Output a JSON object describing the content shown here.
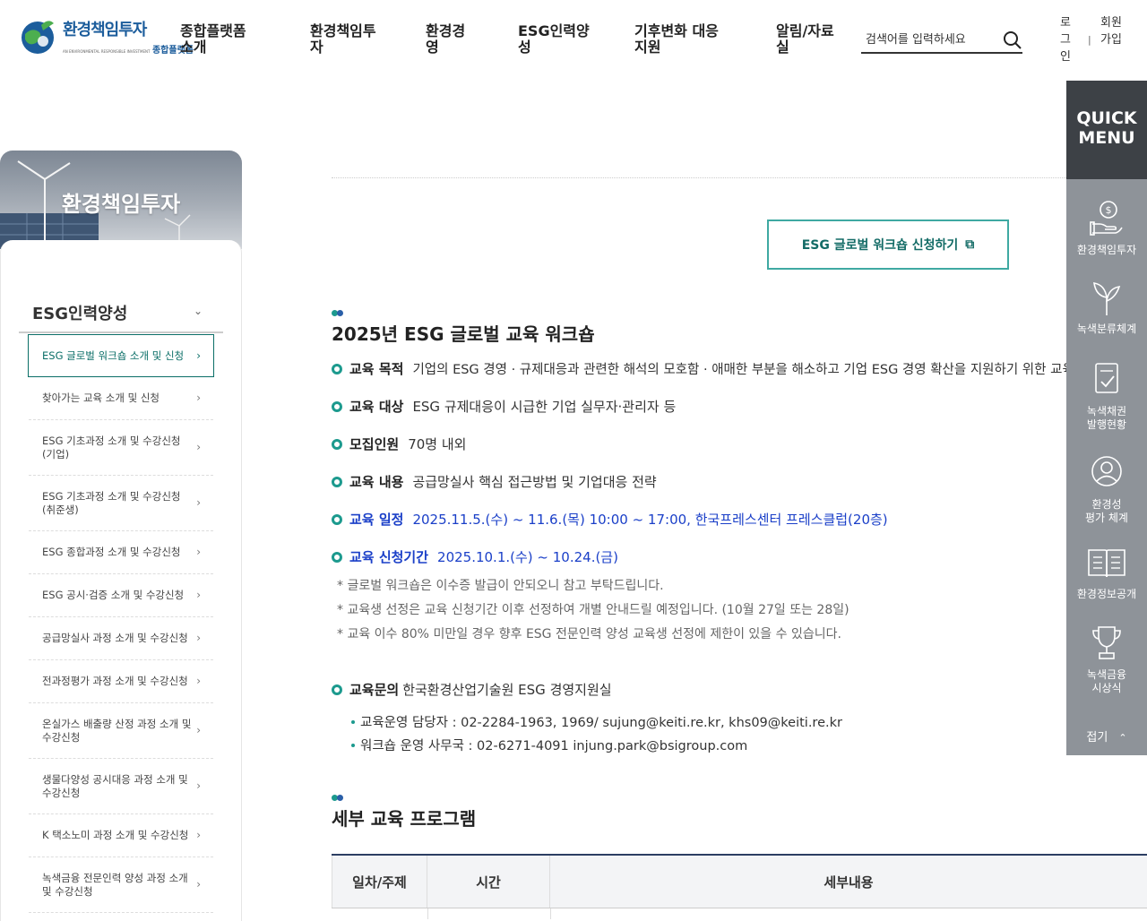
{
  "header": {
    "logo_title": "환경책임투자",
    "logo_sub_en": "AN ENVIRONMENTAL RESPONSIBLE INVESTMENT",
    "logo_sub_kr": "종합플랫폼",
    "nav": [
      {
        "line1": "종합플랫폼",
        "line2": "소개"
      },
      {
        "line1": "환경책임투",
        "line2": "자"
      },
      {
        "line1": "환경경",
        "line2": "영"
      },
      {
        "line1": "ESG인력양",
        "line2": "성"
      },
      {
        "line1": "기후변화 대응",
        "line2": "지원"
      },
      {
        "line1": "알림/자료",
        "line2": "실"
      }
    ],
    "search_placeholder": "검색어를 입력하세요",
    "login": [
      "로",
      "그",
      "인"
    ],
    "separator": "|",
    "join": [
      "회원",
      "가입"
    ]
  },
  "sidebar": {
    "banner_title": "환경책임투자",
    "heading": "ESG인력양성",
    "items": [
      {
        "line1": "ESG 글로벌 워크숍 소개 및 신청",
        "line2": ""
      },
      {
        "line1": "찾아가는 교육 소개 및 신청",
        "line2": ""
      },
      {
        "line1": "ESG 기초과정 소개 및 수강신청",
        "line2": "(기업)"
      },
      {
        "line1": "ESG 기초과정 소개 및 수강신청",
        "line2": "(취준생)"
      },
      {
        "line1": "ESG 종합과정 소개 및 수강신청",
        "line2": ""
      },
      {
        "line1": "ESG 공시·검증 소개 및 수강신청",
        "line2": ""
      },
      {
        "line1": "공급망실사 과정 소개 및 수강신청",
        "line2": ""
      },
      {
        "line1": "전과정평가 과정 소개 및 수강신청",
        "line2": ""
      },
      {
        "line1": "온실가스 배출량 산정 과정 소개 및",
        "line2": "수강신청"
      },
      {
        "line1": "생물다양성 공시대응 과정 소개 및",
        "line2": "수강신청"
      },
      {
        "line1": "K 택소노미 과정 소개 및 수강신청",
        "line2": ""
      },
      {
        "line1": "녹색금융 전문인력 양성 과정 소개",
        "line2": "및 수강신청"
      }
    ]
  },
  "main": {
    "apply_button": "ESG 글로벌 워크숍 신청하기",
    "section1_title": "2025년 ESG 글로벌 교육 워크숍",
    "info": [
      {
        "label": "교육 목적",
        "value": "기업의 ESG 경영 · 규제대응과 관련한 해석의 모호함 · 애매한 부분을 해소하고 기업 ESG 경영 확산을 지원하기 위한 교육의 장 마련"
      },
      {
        "label": "교육 대상",
        "value": "ESG 규제대응이 시급한 기업 실무자·관리자 등"
      },
      {
        "label": "모집인원",
        "value": "70명 내외"
      },
      {
        "label": "교육 내용",
        "value": "공급망실사 핵심 접근방법 및 기업대응 전략"
      },
      {
        "label": "교육 일정",
        "value": "2025.11.5.(수) ~ 11.6.(목) 10:00 ~ 17:00, 한국프레스센터 프레스클럽(20층)"
      },
      {
        "label": "교육 신청기간",
        "value": "2025.10.1.(수) ~ 10.24.(금)"
      }
    ],
    "notes": [
      "* 글로벌 워크숍은 이수증 발급이 안되오니 참고 부탁드립니다.",
      "* 교육생 선정은 교육 신청기간 이후 선정하여 개별 안내드릴 예정입니다. (10월 27일 또는 28일)",
      "* 교육 이수 80% 미만일 경우 향후 ESG 전문인력 양성 교육생 선정에 제한이 있을 수 있습니다."
    ],
    "inquiry_label": "교육문의",
    "inquiry_value": "한국환경산업기술원 ESG 경영지원실",
    "contacts": [
      "교육운영 담당자 : 02-2284-1963, 1969/  sujung@keiti.re.kr, khs09@keiti.re.kr",
      "워크숍 운영 사무국 : 02-6271-4091  injung.park@bsigroup.com"
    ],
    "section2_title": "세부 교육 프로그램",
    "table_headers": [
      "일차/주제",
      "시간",
      "세부내용"
    ]
  },
  "quick_menu": {
    "title_line1": "QUICK",
    "title_line2": "MENU",
    "items": [
      {
        "line1": "환경책임투자",
        "line2": "",
        "icon": "hand-coin-icon"
      },
      {
        "line1": "녹색분류체계",
        "line2": "",
        "icon": "sprout-icon"
      },
      {
        "line1": "녹색채권",
        "line2": "발행현황",
        "icon": "document-check-icon"
      },
      {
        "line1": "환경성",
        "line2": "평가 체계",
        "icon": "user-circle-icon"
      },
      {
        "line1": "환경정보공개",
        "line2": "",
        "icon": "open-book-icon"
      },
      {
        "line1": "녹색금융",
        "line2": "시상식",
        "icon": "trophy-icon"
      }
    ],
    "fold_label": "접기"
  },
  "colors": {
    "accent_teal": "#1c9a8e",
    "accent_blue": "#1a3fc8",
    "quick_menu_bg": "#8e9399",
    "quick_menu_head": "#3d4146"
  }
}
